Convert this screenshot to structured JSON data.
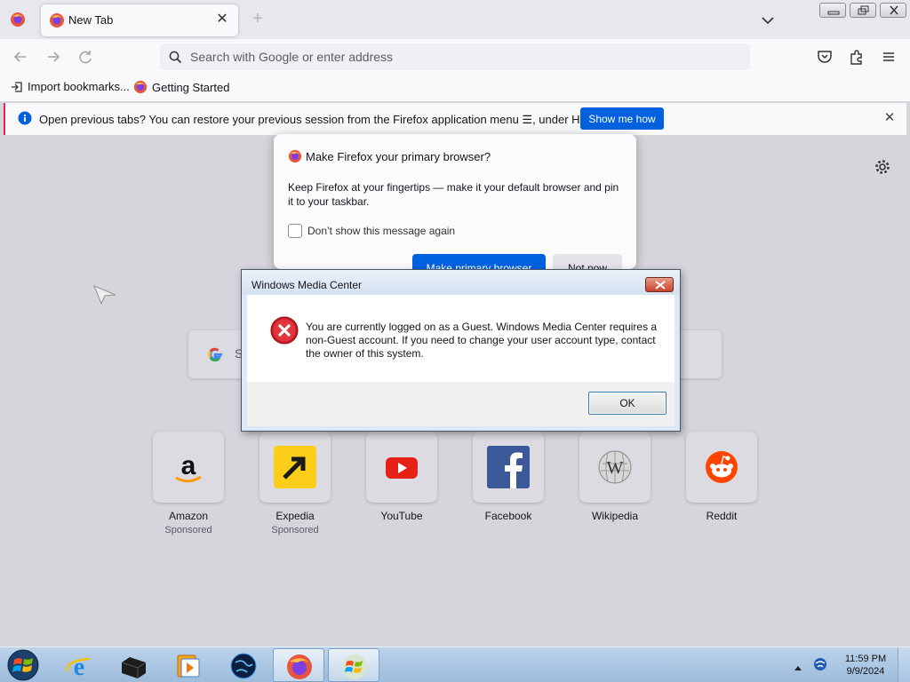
{
  "browser": {
    "tab": {
      "title": "New Tab"
    },
    "urlbar": {
      "placeholder": "Search with Google or enter address"
    },
    "bookmarks": [
      {
        "label": "Import bookmarks..."
      },
      {
        "label": "Getting Started"
      }
    ],
    "notification": {
      "text": "Open previous tabs? You can restore your previous session from the Firefox application menu ☰, under History.",
      "button": "Show me how"
    },
    "search": {
      "placeholder": "S"
    },
    "shortcuts": [
      {
        "name": "Amazon",
        "sub": "Sponsored",
        "icon": "amazon-logo"
      },
      {
        "name": "Expedia",
        "sub": "Sponsored",
        "icon": "expedia-logo"
      },
      {
        "name": "YouTube",
        "sub": "",
        "icon": "youtube-logo"
      },
      {
        "name": "Facebook",
        "sub": "",
        "icon": "facebook-logo"
      },
      {
        "name": "Wikipedia",
        "sub": "",
        "icon": "wikipedia-logo"
      },
      {
        "name": "Reddit",
        "sub": "",
        "icon": "reddit-logo"
      }
    ]
  },
  "ff_dialog": {
    "title": "Make Firefox your primary browser?",
    "body": "Keep Firefox at your fingertips — make it your default browser and pin it to your taskbar.",
    "checkbox": "Don’t show this message again",
    "primary_button": "Make primary browser",
    "secondary_button": "Not now"
  },
  "wmc_dialog": {
    "title": "Windows Media Center",
    "message": "You are currently logged on as a Guest. Windows Media Center requires a non-Guest account. If you need to change your user account type, contact the owner of this system.",
    "ok": "OK",
    "icon": "error-icon"
  },
  "taskbar": {
    "items": [
      "internet-explorer",
      "media-center-box",
      "media-player",
      "globe",
      "firefox",
      "windows-flag"
    ],
    "time": "11:59 PM",
    "date": "9/9/2024"
  },
  "colors": {
    "accent": "#0061e0",
    "notification_stripe": "#e22850",
    "error_red": "#d42027",
    "taskbar": "#a8c4e0"
  }
}
